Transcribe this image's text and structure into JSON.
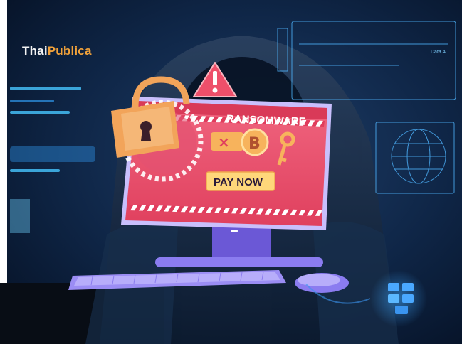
{
  "brand": {
    "part1": "Thai",
    "part2": "Publica"
  },
  "screen": {
    "title": "RANSOMWARE",
    "button_label": "PAY NOW"
  },
  "hud": {
    "label": "Data A"
  },
  "colors": {
    "background": "#0a1a33",
    "screen_red": "#ee4f6a",
    "lock_orange": "#f2a45a",
    "keyboard_purple": "#8b7cf0",
    "brand_orange": "#f2a23a"
  }
}
